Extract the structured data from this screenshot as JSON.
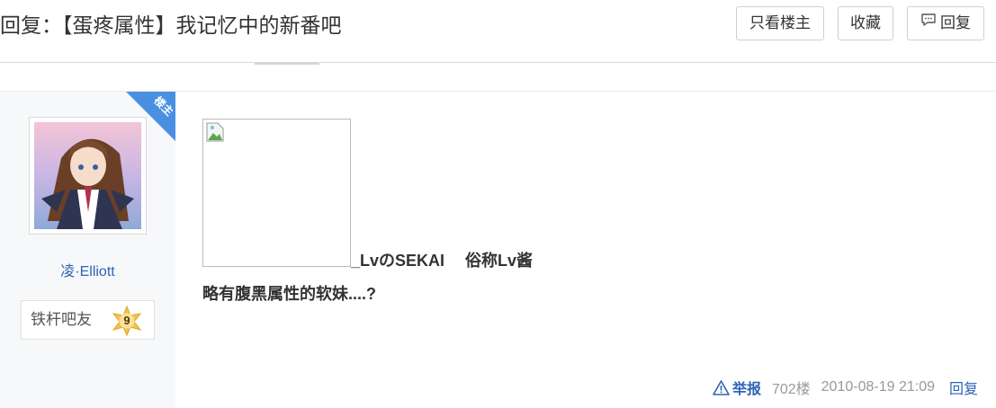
{
  "header": {
    "title": "回复：【蛋疼属性】我记忆中的新番吧",
    "buttons": {
      "see_op_only": "只看楼主",
      "favorite": "收藏",
      "reply": "回复"
    }
  },
  "author": {
    "badge": "楼主",
    "name": "凌·Elliott",
    "level_title": "铁杆吧友",
    "level": "9"
  },
  "post": {
    "line1": "_LvのSEKAI　 俗称Lv酱",
    "line2": "略有腹黑属性的软妹....?"
  },
  "footer": {
    "report": "举报",
    "floor": "702楼",
    "time": "2010-08-19 21:09",
    "reply": "回复"
  },
  "colors": {
    "link": "#2d64b3",
    "badge": "#4a90e2",
    "level_star": "#f5c24a",
    "sidebar_bg": "#f7f8fa"
  },
  "icons": {
    "reply_button": "comment-icon",
    "report": "warning-icon",
    "broken_image": "broken-image-icon"
  }
}
